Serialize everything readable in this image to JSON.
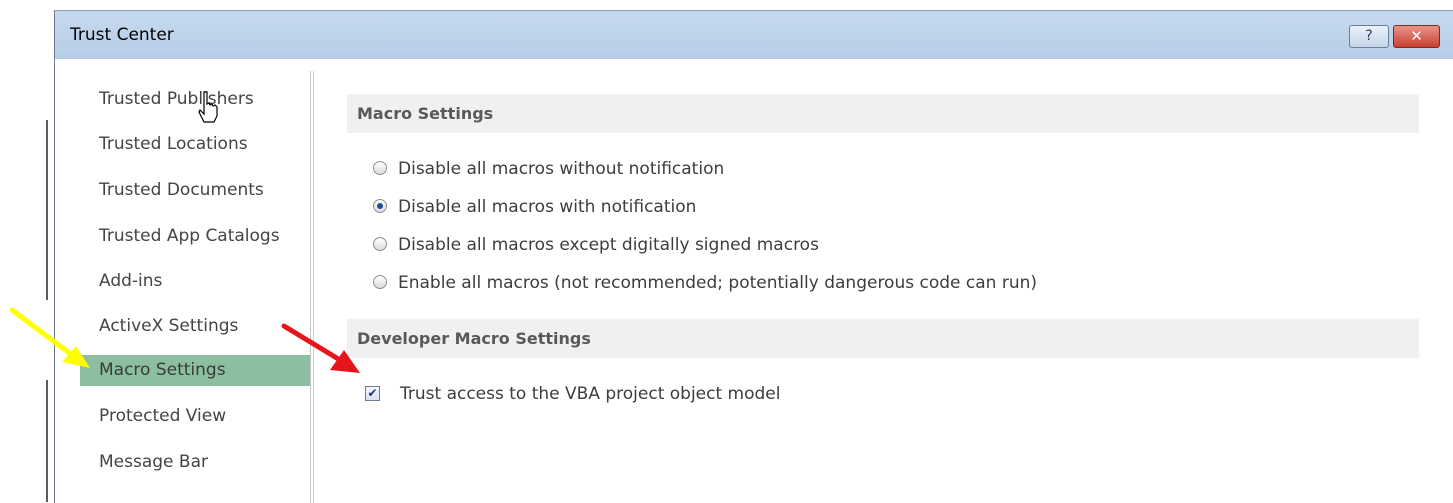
{
  "window": {
    "title": "Trust Center",
    "help_label": "?",
    "close_label": "✕"
  },
  "sidebar": {
    "items": [
      {
        "label": "Trusted Publishers",
        "selected": false
      },
      {
        "label": "Trusted Locations",
        "selected": false
      },
      {
        "label": "Trusted Documents",
        "selected": false
      },
      {
        "label": "Trusted App Catalogs",
        "selected": false
      },
      {
        "label": "Add-ins",
        "selected": false
      },
      {
        "label": "ActiveX Settings",
        "selected": false
      },
      {
        "label": "Macro Settings",
        "selected": true
      },
      {
        "label": "Protected View",
        "selected": false
      },
      {
        "label": "Message Bar",
        "selected": false
      }
    ]
  },
  "macro_settings": {
    "header": "Macro Settings",
    "options": [
      {
        "label": "Disable all macros without notification",
        "checked": false
      },
      {
        "label": "Disable all macros with notification",
        "checked": true
      },
      {
        "label": "Disable all macros except digitally signed macros",
        "checked": false
      },
      {
        "label": "Enable all macros (not recommended; potentially dangerous code can run)",
        "checked": false
      }
    ]
  },
  "developer_macro_settings": {
    "header": "Developer Macro Settings",
    "trust_vba_label": "Trust access to the VBA project object model",
    "trust_vba_checked": true,
    "check_glyph": "✔"
  },
  "annotations": {
    "yellow_arrow_color": "#ffff00",
    "red_arrow_color": "#e8141c"
  },
  "colors": {
    "titlebar": "#c0d4eb",
    "selected_item": "#8cbf9f",
    "section_header_bg": "#f0f0f0"
  }
}
